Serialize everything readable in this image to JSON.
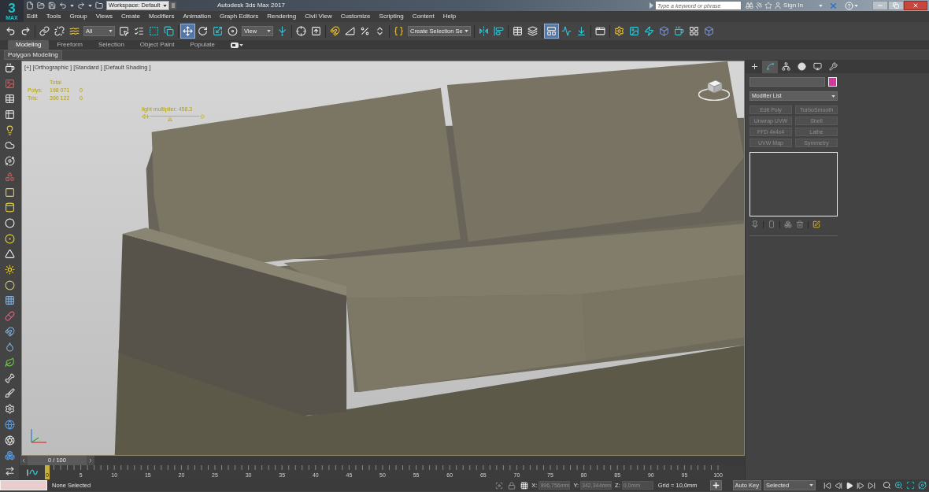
{
  "app_logo": {
    "numeral": "3",
    "caption": "MAX"
  },
  "quick_access": {
    "workspace": "Workspace: Default"
  },
  "window": {
    "title": "Autodesk 3ds Max 2017"
  },
  "search": {
    "placeholder": "Type a keyword or phrase"
  },
  "account": {
    "sign_in": "Sign In"
  },
  "menu": [
    "Edit",
    "Tools",
    "Group",
    "Views",
    "Create",
    "Modifiers",
    "Animation",
    "Graph Editors",
    "Rendering",
    "Civil View",
    "Customize",
    "Scripting",
    "Content",
    "Help"
  ],
  "main_toolbar": {
    "selection_filter": "All",
    "coordinate_system": "View",
    "named_selection": "Create Selection Se",
    "buttons": [
      {
        "selected": false
      },
      {
        "selected": false
      },
      {
        "selected": false
      },
      {
        "selected": false
      },
      {
        "selected": false
      },
      {
        "selected": false
      },
      {
        "selected": false
      },
      {
        "selected": false
      },
      {
        "selected": false
      },
      {
        "selected": true
      },
      {
        "selected": false
      },
      {
        "selected": false
      },
      {
        "selected": false
      },
      {
        "selected": false
      },
      {
        "selected": false
      },
      {
        "selected": false
      },
      {
        "selected": false
      },
      {
        "selected": false
      },
      {
        "selected": false
      },
      {
        "selected": false
      },
      {
        "selected": false
      },
      {
        "selected": false
      },
      {
        "selected": false
      },
      {
        "selected": false
      },
      {
        "selected": false
      },
      {
        "selected": true
      },
      {
        "selected": false
      },
      {
        "selected": false
      },
      {
        "selected": false
      },
      {
        "selected": false
      },
      {
        "selected": false
      },
      {
        "selected": false
      },
      {
        "selected": false
      },
      {
        "selected": false
      },
      {
        "selected": false
      },
      {
        "selected": false
      }
    ]
  },
  "ribbon": {
    "tabs": [
      {
        "label": "Modeling",
        "selected": true
      },
      {
        "label": "Freeform",
        "selected": false
      },
      {
        "label": "Selection",
        "selected": false
      },
      {
        "label": "Object Paint",
        "selected": false
      },
      {
        "label": "Populate",
        "selected": false
      }
    ],
    "panel_tab": "Polygon Modeling"
  },
  "viewport": {
    "labels": [
      "[+]",
      "[Orthographic ]",
      "[Standard ]",
      "[Default Shading ]"
    ],
    "stats": {
      "header": "Total",
      "rows": [
        {
          "label": "Polys:",
          "values": [
            "198 071",
            "0"
          ]
        },
        {
          "label": "Tris:",
          "values": [
            "390 122",
            "0"
          ]
        }
      ]
    },
    "light_multiplier": {
      "label": "light multiplier: 458.3",
      "level": 0.41
    }
  },
  "command_panel": {
    "tabs": [
      {
        "selected": false
      },
      {
        "selected": true
      },
      {
        "selected": false
      },
      {
        "selected": false
      },
      {
        "selected": false
      },
      {
        "selected": false
      }
    ],
    "modifier_list": "Modifier List",
    "modifiers": [
      {
        "label": "Edit Poly",
        "disabled": true
      },
      {
        "label": "TurboSmooth",
        "disabled": true
      },
      {
        "label": "Unwrap UVW",
        "disabled": true
      },
      {
        "label": "Shell",
        "disabled": true
      },
      {
        "label": "FFD 4x4x4",
        "disabled": true
      },
      {
        "label": "Lathe",
        "disabled": true
      },
      {
        "label": "UVW Map",
        "disabled": true
      },
      {
        "label": "Symmetry",
        "disabled": true
      }
    ]
  },
  "time_slider": {
    "label": "0 / 100",
    "level": 0
  },
  "track_bar": {
    "frame_labels": [
      "0",
      "5",
      "10",
      "15",
      "20",
      "25",
      "30",
      "35",
      "40",
      "45",
      "50",
      "55",
      "60",
      "65",
      "70",
      "75",
      "80",
      "85",
      "90",
      "95",
      "100"
    ]
  },
  "status_bar": {
    "selection": "None Selected",
    "coordinates": [
      {
        "label": "X:",
        "value": "996,756mm"
      },
      {
        "label": "Y:",
        "value": "342,344mm"
      },
      {
        "label": "Z:",
        "value": "0,0mm"
      }
    ],
    "grid": "Grid = 10,0mm",
    "auto_key": {
      "label": "Auto Key",
      "on": false
    },
    "key_filter": "Selected"
  }
}
